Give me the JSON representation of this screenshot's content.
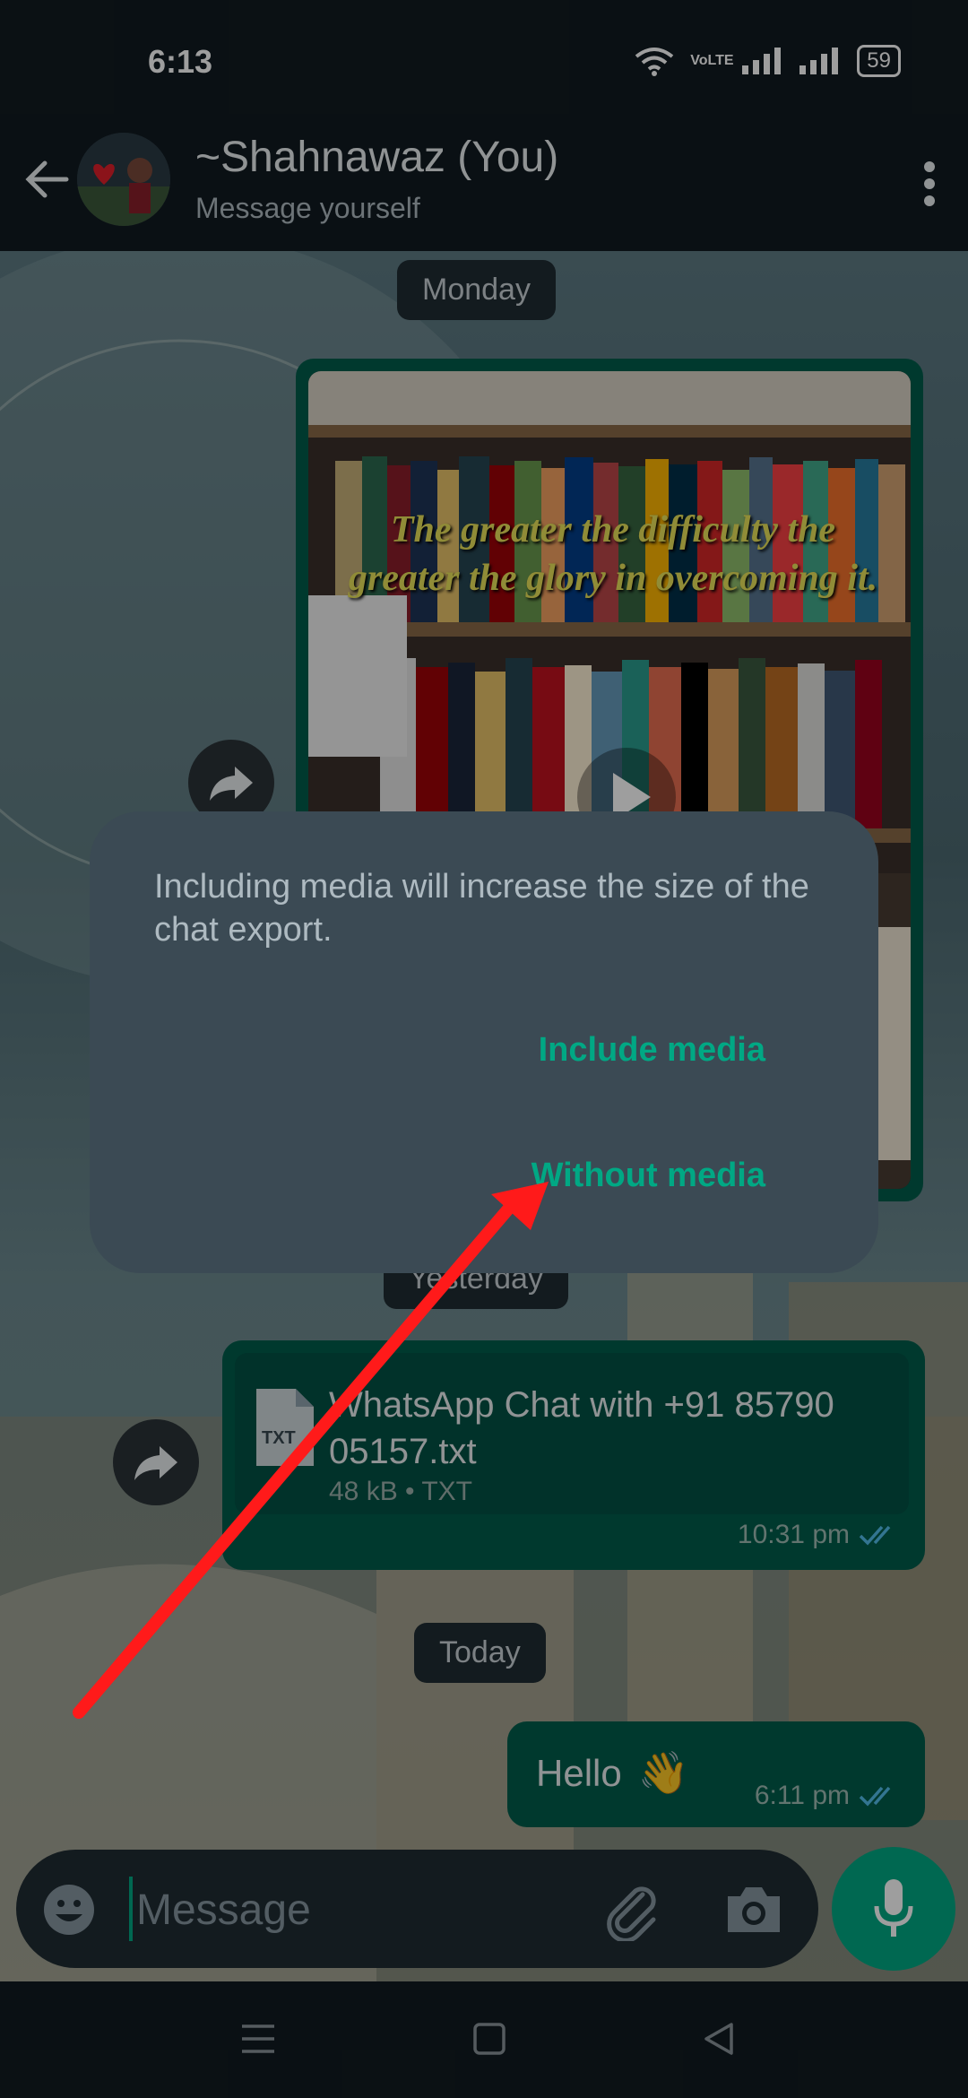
{
  "status_bar": {
    "time": "6:13",
    "network": "VoLTE",
    "battery": "59"
  },
  "header": {
    "contact_name": "~Shahnawaz (You)",
    "subtitle": "Message yourself"
  },
  "chat": {
    "date_monday": "Monday",
    "video_quote": "The greater the difficulty the greater the glory in overcoming it.",
    "date_yesterday": "Yesterday",
    "file": {
      "icon_label": "TXT",
      "name": "WhatsApp Chat with +91 85790 05157.txt",
      "meta": "48 kB • TXT",
      "time": "10:31 pm"
    },
    "date_today": "Today",
    "hello": {
      "text": "Hello",
      "emoji": "👋",
      "time": "6:11 pm"
    }
  },
  "dialog": {
    "message": "Including media will increase the size of the chat export.",
    "include_label": "Include media",
    "without_label": "Without media"
  },
  "input": {
    "placeholder": "Message"
  },
  "colors": {
    "accent": "#00a884",
    "bubble": "#005c4b",
    "dialog": "#3b4a54",
    "annotation_arrow": "#ff1a1a"
  }
}
